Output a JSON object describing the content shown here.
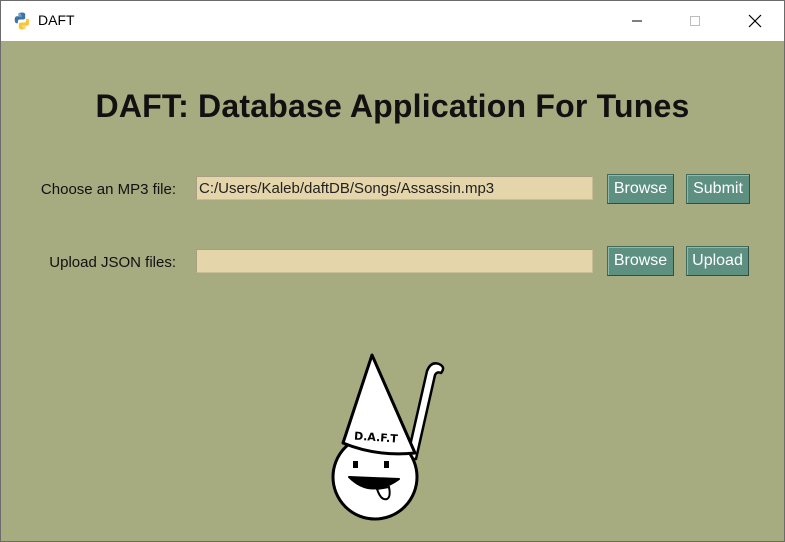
{
  "window": {
    "title": "DAFT",
    "icon": "python-icon",
    "controls": [
      "minimize-icon",
      "maximize-icon",
      "close-icon"
    ]
  },
  "main": {
    "heading": "DAFT: Database Application For Tunes",
    "mp3_row": {
      "label": "Choose an MP3 file:",
      "value": "C:/Users/Kaleb/daftDB/Songs/Assassin.mp3",
      "browse_label": "Browse",
      "submit_label": "Submit"
    },
    "json_row": {
      "label": "Upload JSON files:",
      "value": "",
      "browse_label": "Browse",
      "upload_label": "Upload"
    },
    "logo": {
      "hat_text": "D.A.F.T"
    }
  },
  "colors": {
    "background": "#a6ab80",
    "entry": "#e5d5aa",
    "button": "#5d9080",
    "button_text": "#ffffff"
  }
}
